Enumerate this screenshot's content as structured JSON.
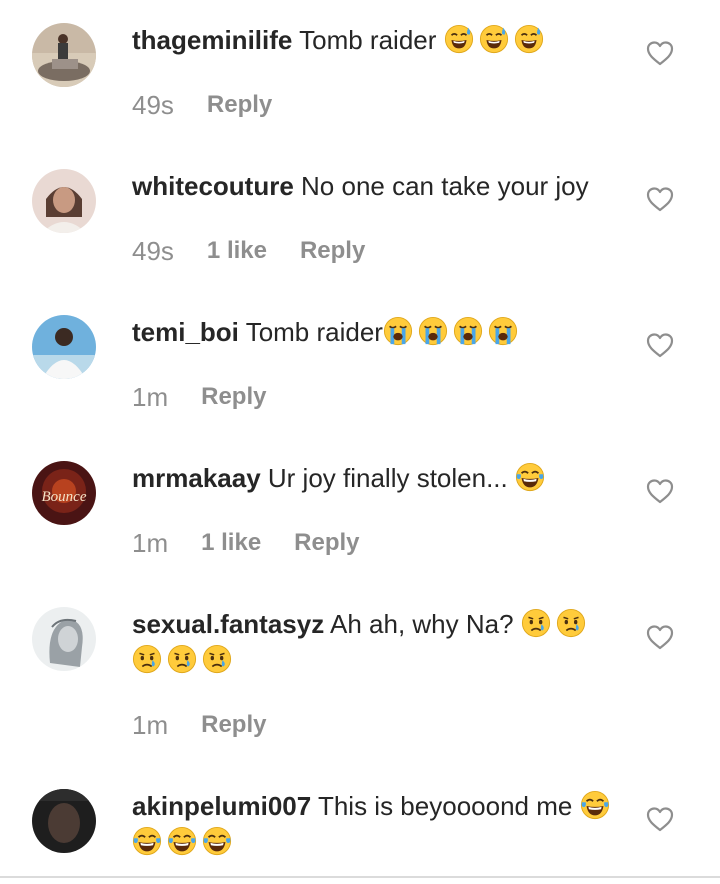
{
  "comments": [
    {
      "username": "thageminilife",
      "text": "Tomb raider",
      "emojis": [
        "sweat-smile-icon",
        "sweat-smile-icon",
        "sweat-smile-icon"
      ],
      "time": "49s",
      "likes": "",
      "reply_label": "Reply"
    },
    {
      "username": "whitecouture",
      "text": "No one can take your joy",
      "emojis": [],
      "time": "49s",
      "likes": "1 like",
      "reply_label": "Reply"
    },
    {
      "username": "temi_boi",
      "text": "Tomb raider",
      "emojis": [
        "loudly-crying-icon",
        "loudly-crying-icon",
        "loudly-crying-icon",
        "loudly-crying-icon"
      ],
      "time": "1m",
      "likes": "",
      "reply_label": "Reply"
    },
    {
      "username": "mrmakaay",
      "text": "Ur joy finally stolen...",
      "emojis": [
        "tears-of-joy-icon"
      ],
      "time": "1m",
      "likes": "1 like",
      "reply_label": "Reply"
    },
    {
      "username": "sexual.fantasyz",
      "text": "Ah ah, why Na?",
      "emojis": [
        "crying-face-icon",
        "crying-face-icon",
        "crying-face-icon",
        "crying-face-icon",
        "crying-face-icon"
      ],
      "time": "1m",
      "likes": "",
      "reply_label": "Reply"
    },
    {
      "username": "akinpelumi007",
      "text": "This is beyoooond me",
      "emojis": [
        "tears-of-joy-icon",
        "tears-of-joy-icon",
        "tears-of-joy-icon",
        "tears-of-joy-icon"
      ],
      "time": "",
      "likes": "",
      "reply_label": ""
    }
  ],
  "avatar_text": {
    "bounce": "Bounce"
  },
  "colors": {
    "text": "#262626",
    "meta": "#8e8e8e",
    "heart_outline": "#8e8e8e",
    "emoji_yellow": "#ffcb3b",
    "tear_blue": "#4aa6e8"
  }
}
